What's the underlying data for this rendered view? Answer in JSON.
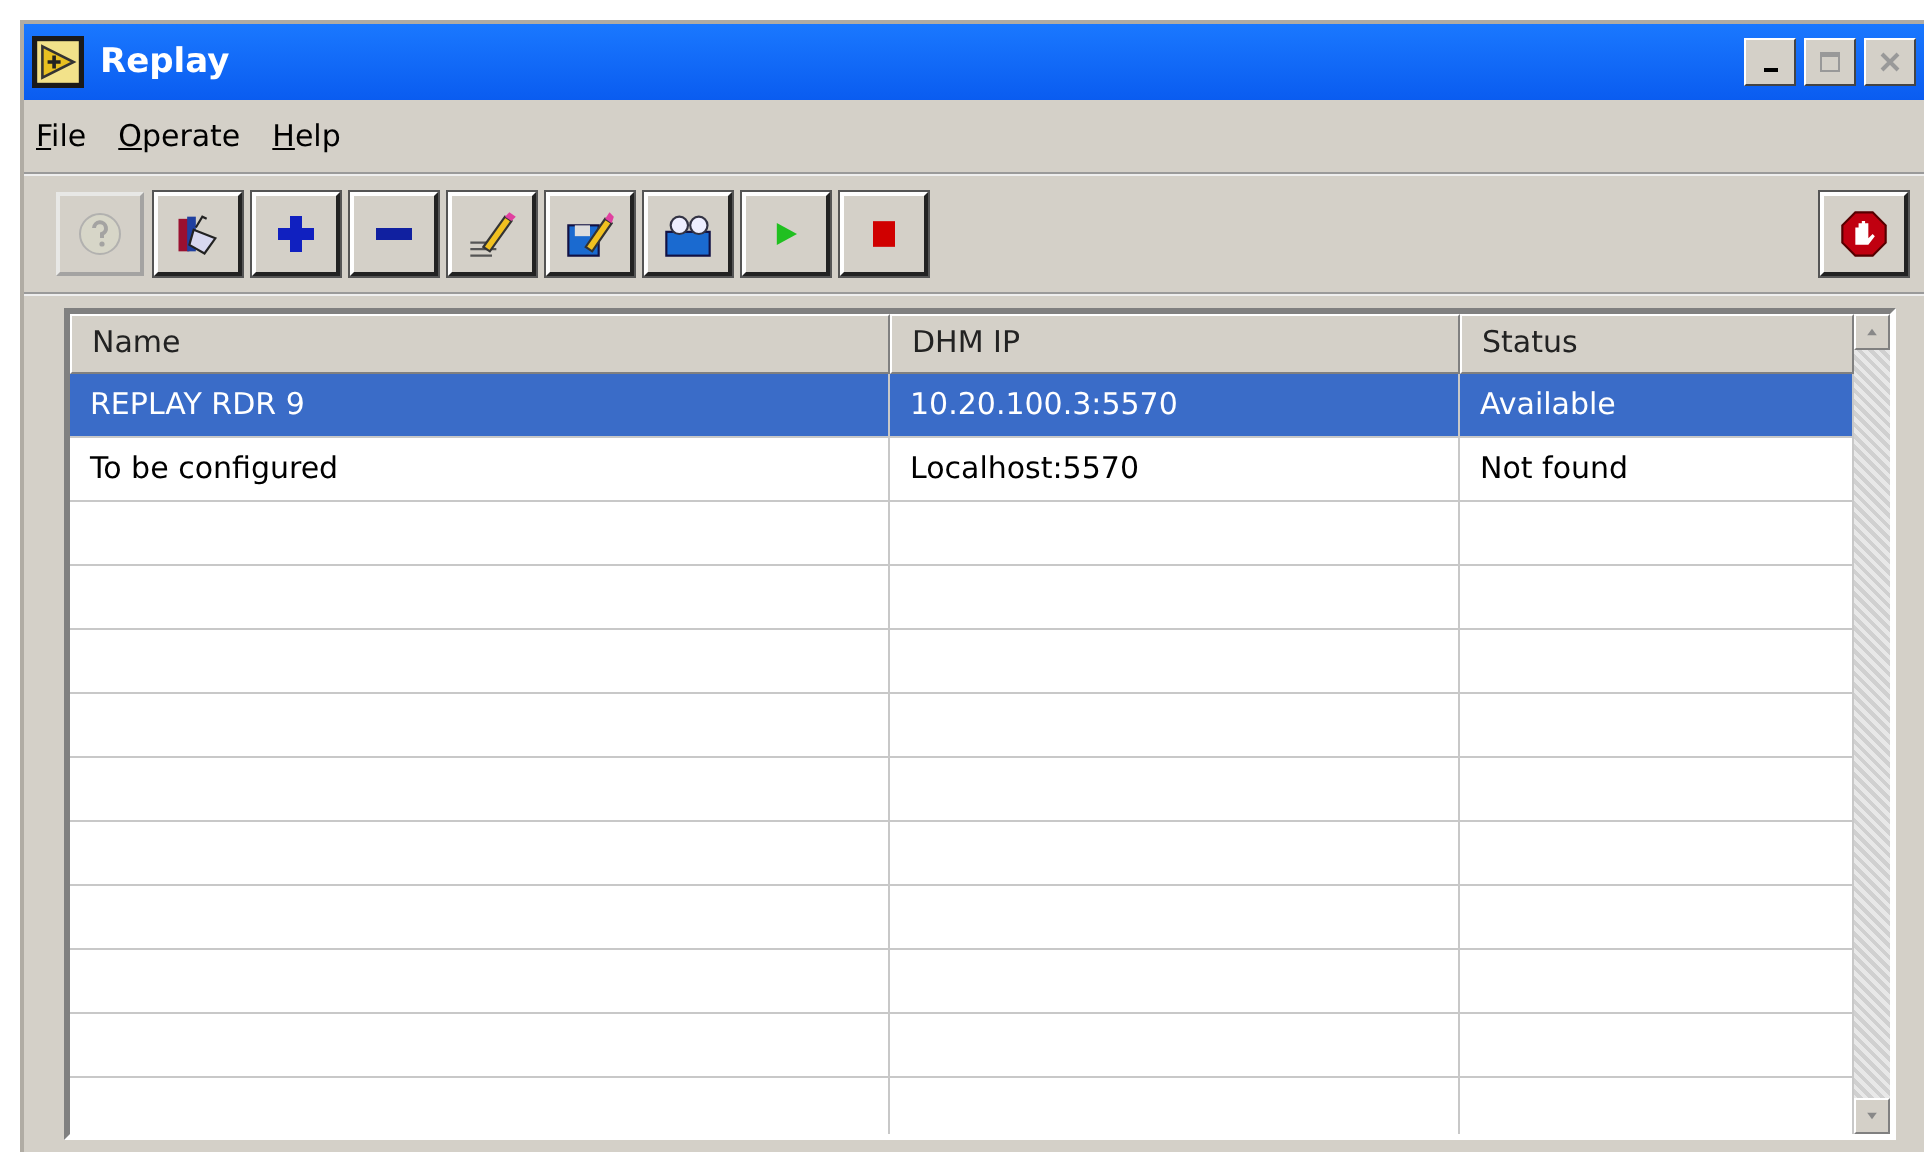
{
  "window": {
    "title": "Replay"
  },
  "menu": [
    "File",
    "Operate",
    "Help"
  ],
  "toolbar": [
    {
      "kind": "help",
      "disabled": true
    },
    {
      "kind": "book",
      "disabled": false
    },
    {
      "kind": "plus",
      "disabled": false
    },
    {
      "kind": "minus",
      "disabled": false
    },
    {
      "kind": "pencil",
      "disabled": false
    },
    {
      "kind": "floppy",
      "disabled": false
    },
    {
      "kind": "binoculars",
      "disabled": false
    },
    {
      "kind": "play",
      "disabled": false
    },
    {
      "kind": "stop",
      "disabled": false
    }
  ],
  "halt_button": {
    "kind": "halt"
  },
  "table": {
    "columns": [
      "Name",
      "DHM IP",
      "Status"
    ],
    "rows": [
      {
        "cells": [
          "REPLAY RDR 9",
          "10.20.100.3:5570",
          "Available"
        ],
        "selected": true
      },
      {
        "cells": [
          "To be configured",
          "Localhost:5570",
          "Not found"
        ],
        "selected": false
      }
    ]
  }
}
